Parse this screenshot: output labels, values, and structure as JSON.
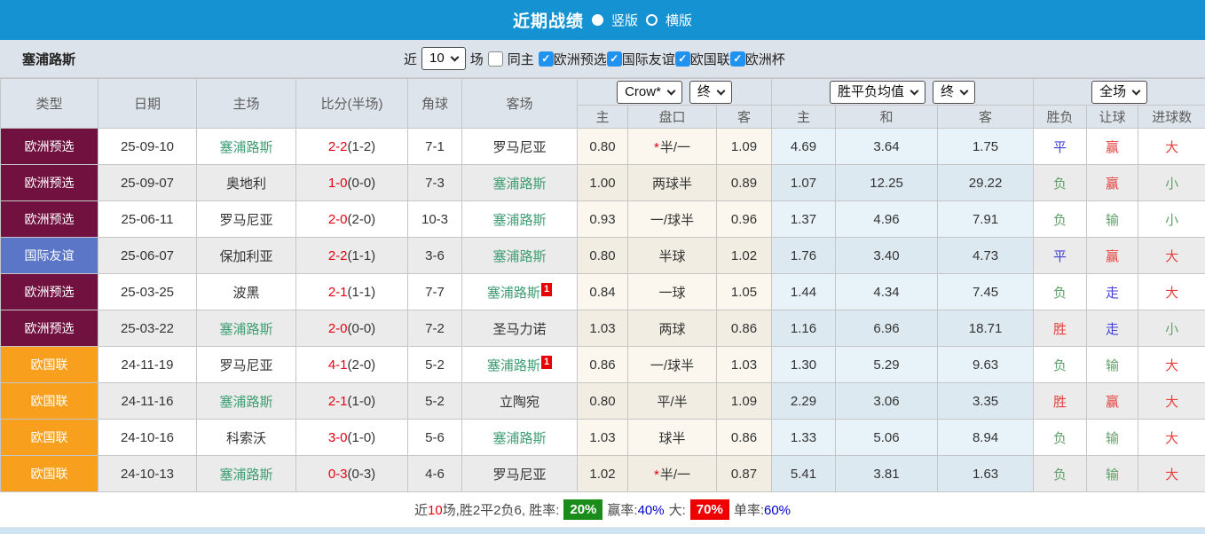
{
  "colors": {
    "topbar_blue": "#1592d2",
    "type_badge": {
      "欧洲预选": "#70113f",
      "国际友谊": "#5b76c6",
      "欧国联": "#f8a01e"
    },
    "result_text": {
      "red": "#e5413f",
      "green": "#61a169",
      "blue": "#4242d8"
    },
    "team_highlight_green": "#3f9e74",
    "score_red": "#e60012",
    "summary_green_box": "#1a8c1a",
    "summary_red_box": "#ee0000",
    "summary_blue_text": "#0000cc",
    "checkbox_blue": "#1f93ef"
  },
  "header_bar": {
    "title": "近期战绩",
    "options": [
      {
        "label": "竖版",
        "selected": true
      },
      {
        "label": "横版",
        "selected": false
      }
    ]
  },
  "filter_bar": {
    "team": "塞浦路斯",
    "recent_label": "近",
    "recent_value": "10",
    "games_label": "场",
    "same_home_label": "同主",
    "same_home_checked": false,
    "competitions": [
      {
        "label": "欧洲预选",
        "checked": true
      },
      {
        "label": "国际友谊",
        "checked": true
      },
      {
        "label": "欧国联",
        "checked": true
      },
      {
        "label": "欧洲杯",
        "checked": true
      }
    ]
  },
  "table": {
    "main_headers": [
      "类型",
      "日期",
      "主场",
      "比分(半场)",
      "角球",
      "客场"
    ],
    "odds_group": {
      "selects": [
        "Crow*",
        "终"
      ],
      "sub": [
        "主",
        "盘口",
        "客"
      ]
    },
    "mean_group": {
      "selects": [
        "胜平负均值",
        "终"
      ],
      "sub": [
        "主",
        "和",
        "客"
      ]
    },
    "result_group": {
      "selects": [
        "全场"
      ],
      "sub": [
        "胜负",
        "让球",
        "进球数"
      ]
    },
    "rows": [
      {
        "type": "欧洲预选",
        "date": "25-09-10",
        "home": {
          "name": "塞浦路斯",
          "highlight": true,
          "sup": ""
        },
        "score_ft": "2-2",
        "score_ht": "(1-2)",
        "corners": "7-1",
        "away": {
          "name": "罗马尼亚",
          "highlight": false,
          "sup": ""
        },
        "odds_home": "0.80",
        "handicap": "半/一",
        "handicap_star": true,
        "odds_away": "1.09",
        "mean_win": "4.69",
        "mean_draw": "3.64",
        "mean_lose": "1.75",
        "result": {
          "text": "平",
          "color": "blue"
        },
        "handicap_result": {
          "text": "赢",
          "color": "red"
        },
        "goals": {
          "text": "大",
          "color": "red"
        }
      },
      {
        "type": "欧洲预选",
        "date": "25-09-07",
        "home": {
          "name": "奥地利",
          "highlight": false,
          "sup": ""
        },
        "score_ft": "1-0",
        "score_ht": "(0-0)",
        "corners": "7-3",
        "away": {
          "name": "塞浦路斯",
          "highlight": true,
          "sup": ""
        },
        "odds_home": "1.00",
        "handicap": "两球半",
        "handicap_star": false,
        "odds_away": "0.89",
        "mean_win": "1.07",
        "mean_draw": "12.25",
        "mean_lose": "29.22",
        "result": {
          "text": "负",
          "color": "green"
        },
        "handicap_result": {
          "text": "赢",
          "color": "red"
        },
        "goals": {
          "text": "小",
          "color": "green"
        }
      },
      {
        "type": "欧洲预选",
        "date": "25-06-11",
        "home": {
          "name": "罗马尼亚",
          "highlight": false,
          "sup": ""
        },
        "score_ft": "2-0",
        "score_ht": "(2-0)",
        "corners": "10-3",
        "away": {
          "name": "塞浦路斯",
          "highlight": true,
          "sup": ""
        },
        "odds_home": "0.93",
        "handicap": "一/球半",
        "handicap_star": false,
        "odds_away": "0.96",
        "mean_win": "1.37",
        "mean_draw": "4.96",
        "mean_lose": "7.91",
        "result": {
          "text": "负",
          "color": "green"
        },
        "handicap_result": {
          "text": "输",
          "color": "green"
        },
        "goals": {
          "text": "小",
          "color": "green"
        }
      },
      {
        "type": "国际友谊",
        "date": "25-06-07",
        "home": {
          "name": "保加利亚",
          "highlight": false,
          "sup": ""
        },
        "score_ft": "2-2",
        "score_ht": "(1-1)",
        "corners": "3-6",
        "away": {
          "name": "塞浦路斯",
          "highlight": true,
          "sup": ""
        },
        "odds_home": "0.80",
        "handicap": "半球",
        "handicap_star": false,
        "odds_away": "1.02",
        "mean_win": "1.76",
        "mean_draw": "3.40",
        "mean_lose": "4.73",
        "result": {
          "text": "平",
          "color": "blue"
        },
        "handicap_result": {
          "text": "赢",
          "color": "red"
        },
        "goals": {
          "text": "大",
          "color": "red"
        }
      },
      {
        "type": "欧洲预选",
        "date": "25-03-25",
        "home": {
          "name": "波黑",
          "highlight": false,
          "sup": ""
        },
        "score_ft": "2-1",
        "score_ht": "(1-1)",
        "corners": "7-7",
        "away": {
          "name": "塞浦路斯",
          "highlight": true,
          "sup": "1"
        },
        "odds_home": "0.84",
        "handicap": "一球",
        "handicap_star": false,
        "odds_away": "1.05",
        "mean_win": "1.44",
        "mean_draw": "4.34",
        "mean_lose": "7.45",
        "result": {
          "text": "负",
          "color": "green"
        },
        "handicap_result": {
          "text": "走",
          "color": "blue"
        },
        "goals": {
          "text": "大",
          "color": "red"
        }
      },
      {
        "type": "欧洲预选",
        "date": "25-03-22",
        "home": {
          "name": "塞浦路斯",
          "highlight": true,
          "sup": ""
        },
        "score_ft": "2-0",
        "score_ht": "(0-0)",
        "corners": "7-2",
        "away": {
          "name": "圣马力诺",
          "highlight": false,
          "sup": ""
        },
        "odds_home": "1.03",
        "handicap": "两球",
        "handicap_star": false,
        "odds_away": "0.86",
        "mean_win": "1.16",
        "mean_draw": "6.96",
        "mean_lose": "18.71",
        "result": {
          "text": "胜",
          "color": "red"
        },
        "handicap_result": {
          "text": "走",
          "color": "blue"
        },
        "goals": {
          "text": "小",
          "color": "green"
        }
      },
      {
        "type": "欧国联",
        "date": "24-11-19",
        "home": {
          "name": "罗马尼亚",
          "highlight": false,
          "sup": ""
        },
        "score_ft": "4-1",
        "score_ht": "(2-0)",
        "corners": "5-2",
        "away": {
          "name": "塞浦路斯",
          "highlight": true,
          "sup": "1"
        },
        "odds_home": "0.86",
        "handicap": "一/球半",
        "handicap_star": false,
        "odds_away": "1.03",
        "mean_win": "1.30",
        "mean_draw": "5.29",
        "mean_lose": "9.63",
        "result": {
          "text": "负",
          "color": "green"
        },
        "handicap_result": {
          "text": "输",
          "color": "green"
        },
        "goals": {
          "text": "大",
          "color": "red"
        }
      },
      {
        "type": "欧国联",
        "date": "24-11-16",
        "home": {
          "name": "塞浦路斯",
          "highlight": true,
          "sup": ""
        },
        "score_ft": "2-1",
        "score_ht": "(1-0)",
        "corners": "5-2",
        "away": {
          "name": "立陶宛",
          "highlight": false,
          "sup": ""
        },
        "odds_home": "0.80",
        "handicap": "平/半",
        "handicap_star": false,
        "odds_away": "1.09",
        "mean_win": "2.29",
        "mean_draw": "3.06",
        "mean_lose": "3.35",
        "result": {
          "text": "胜",
          "color": "red"
        },
        "handicap_result": {
          "text": "赢",
          "color": "red"
        },
        "goals": {
          "text": "大",
          "color": "red"
        }
      },
      {
        "type": "欧国联",
        "date": "24-10-16",
        "home": {
          "name": "科索沃",
          "highlight": false,
          "sup": ""
        },
        "score_ft": "3-0",
        "score_ht": "(1-0)",
        "corners": "5-6",
        "away": {
          "name": "塞浦路斯",
          "highlight": true,
          "sup": ""
        },
        "odds_home": "1.03",
        "handicap": "球半",
        "handicap_star": false,
        "odds_away": "0.86",
        "mean_win": "1.33",
        "mean_draw": "5.06",
        "mean_lose": "8.94",
        "result": {
          "text": "负",
          "color": "green"
        },
        "handicap_result": {
          "text": "输",
          "color": "green"
        },
        "goals": {
          "text": "大",
          "color": "red"
        }
      },
      {
        "type": "欧国联",
        "date": "24-10-13",
        "home": {
          "name": "塞浦路斯",
          "highlight": true,
          "sup": ""
        },
        "score_ft": "0-3",
        "score_ht": "(0-3)",
        "corners": "4-6",
        "away": {
          "name": "罗马尼亚",
          "highlight": false,
          "sup": ""
        },
        "odds_home": "1.02",
        "handicap": "半/一",
        "handicap_star": true,
        "odds_away": "0.87",
        "mean_win": "5.41",
        "mean_draw": "3.81",
        "mean_lose": "1.63",
        "result": {
          "text": "负",
          "color": "green"
        },
        "handicap_result": {
          "text": "输",
          "color": "green"
        },
        "goals": {
          "text": "大",
          "color": "red"
        }
      }
    ]
  },
  "summary": {
    "recent_label": "近",
    "recent_count": "10",
    "stats_text": "场,胜2平2负6, 胜率:",
    "win_rate": "20%",
    "odds_win_label": "赢率:",
    "odds_win_rate": "40%",
    "big_label": "大:",
    "big_rate": "70%",
    "single_label": "单率:",
    "single_rate": "60%"
  }
}
